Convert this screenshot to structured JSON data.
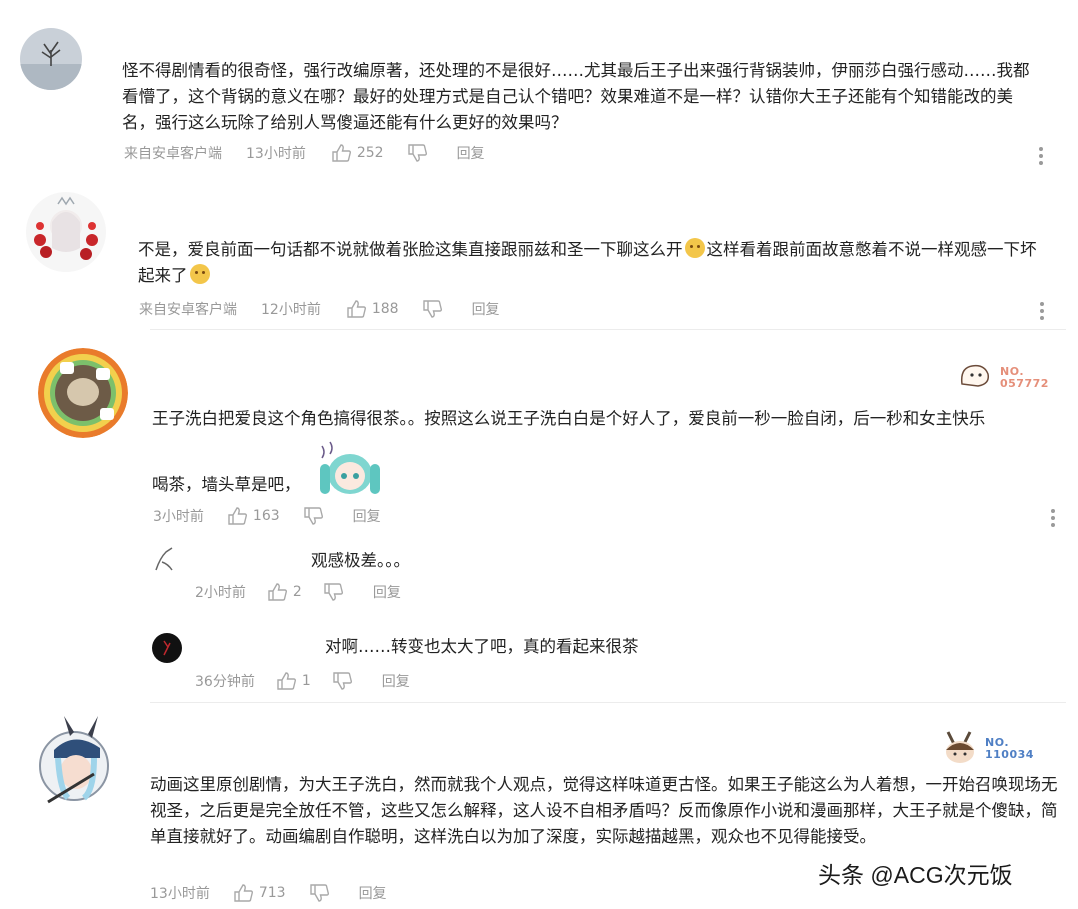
{
  "comments": [
    {
      "text": "怪不得剧情看的很奇怪，强行改编原著，还处理的不是很好……尤其最后王子出来强行背锅装帅，伊丽莎白强行感动……我都看懵了，这个背锅的意义在哪？最好的处理方式是自己认个错吧？效果难道不是一样？认错你大王子还能有个知错能改的美名，强行这么玩除了给别人骂傻逼还能有什么更好的效果吗？",
      "client": "来自安卓客户端",
      "time": "13小时前",
      "likes": "252",
      "reply": "回复"
    },
    {
      "text_a": "不是，爱良前面一句话都不说就做着张脸这集直接跟丽兹和圣一下聊这么开",
      "text_b": "这样看着跟前面故意憋着不说一样观感一下坏起来了",
      "client": "来自安卓客户端",
      "time": "12小时前",
      "likes": "188",
      "reply": "回复"
    },
    {
      "badge": "NO. 057772",
      "text_a": "王子洗白把爱良这个角色搞得很茶。。按照这么说王子洗白白是个好人了，爱良前一秒一脸自闭，后一秒和女主快乐",
      "text_b": "喝茶，墙头草是吧，",
      "time": "3小时前",
      "likes": "163",
      "reply": "回复"
    },
    {
      "badge": "NO. 110034",
      "text": "动画这里原创剧情，为大王子洗白，然而就我个人观点，觉得这样味道更古怪。如果王子能这么为人着想，一开始召唤现场无视圣，之后更是完全放任不管，这些又怎么解释，这人设不自相矛盾吗？反而像原作小说和漫画那样，大王子就是个傻缺，简单直接就好了。动画编剧自作聪明，这样洗白以为加了深度，实际越描越黑，观众也不见得能接受。",
      "time": "13小时前",
      "likes": "713",
      "reply": "回复"
    }
  ],
  "replies": [
    {
      "text": "观感极差。。。",
      "time": "2小时前",
      "likes": "2",
      "reply": "回复"
    },
    {
      "text": "对啊……转变也太大了吧，真的看起来很茶",
      "time": "36分钟前",
      "likes": "1",
      "reply": "回复"
    }
  ],
  "watermark": "头条 @ACG次元饭",
  "icons": {
    "like": "thumb-up-icon",
    "dislike": "thumb-down-icon",
    "more": "more-vertical-icon"
  }
}
